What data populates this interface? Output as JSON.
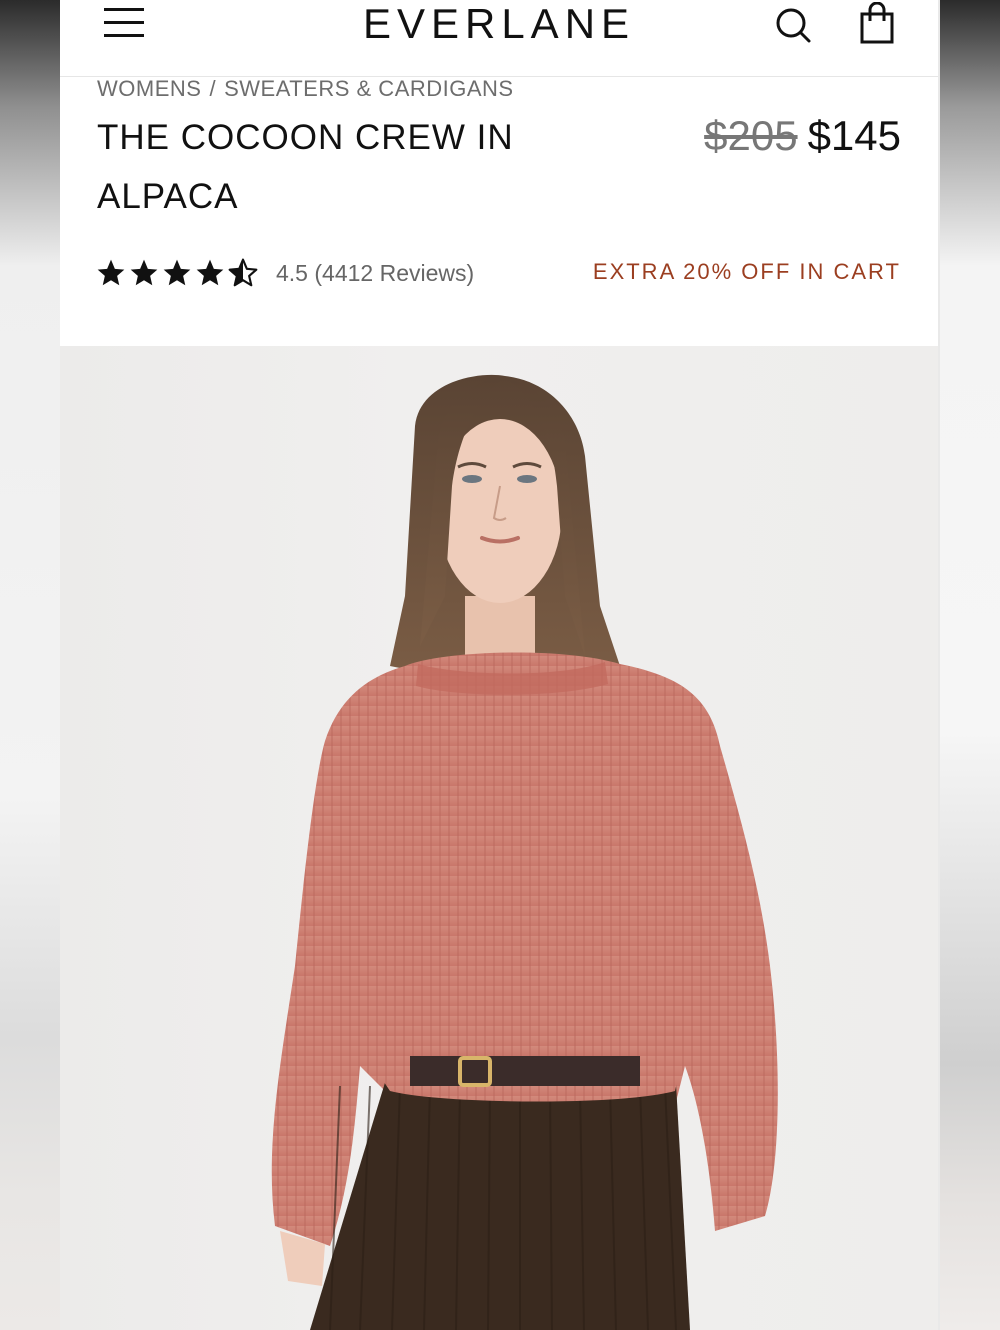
{
  "header": {
    "logo": "EVERLANE",
    "icons": {
      "menu": "hamburger-menu-icon",
      "search": "search-icon",
      "cart": "shopping-bag-icon"
    }
  },
  "breadcrumb": {
    "items": [
      "WOMENS",
      "SWEATERS & CARDIGANS"
    ],
    "separator": "/"
  },
  "product": {
    "title": "THE COCOON CREW IN ALPACA",
    "original_price": "$205",
    "sale_price": "$145",
    "rating": {
      "stars": 4.5,
      "max_stars": 5,
      "text": "4.5 (4412 Reviews)"
    },
    "promo": "EXTRA 20% OFF IN CART",
    "image": {
      "description_icon": "product-model-photo"
    }
  },
  "colors": {
    "promo": "#9b3e20",
    "sweater": "#cf8073",
    "text": "#111111"
  }
}
